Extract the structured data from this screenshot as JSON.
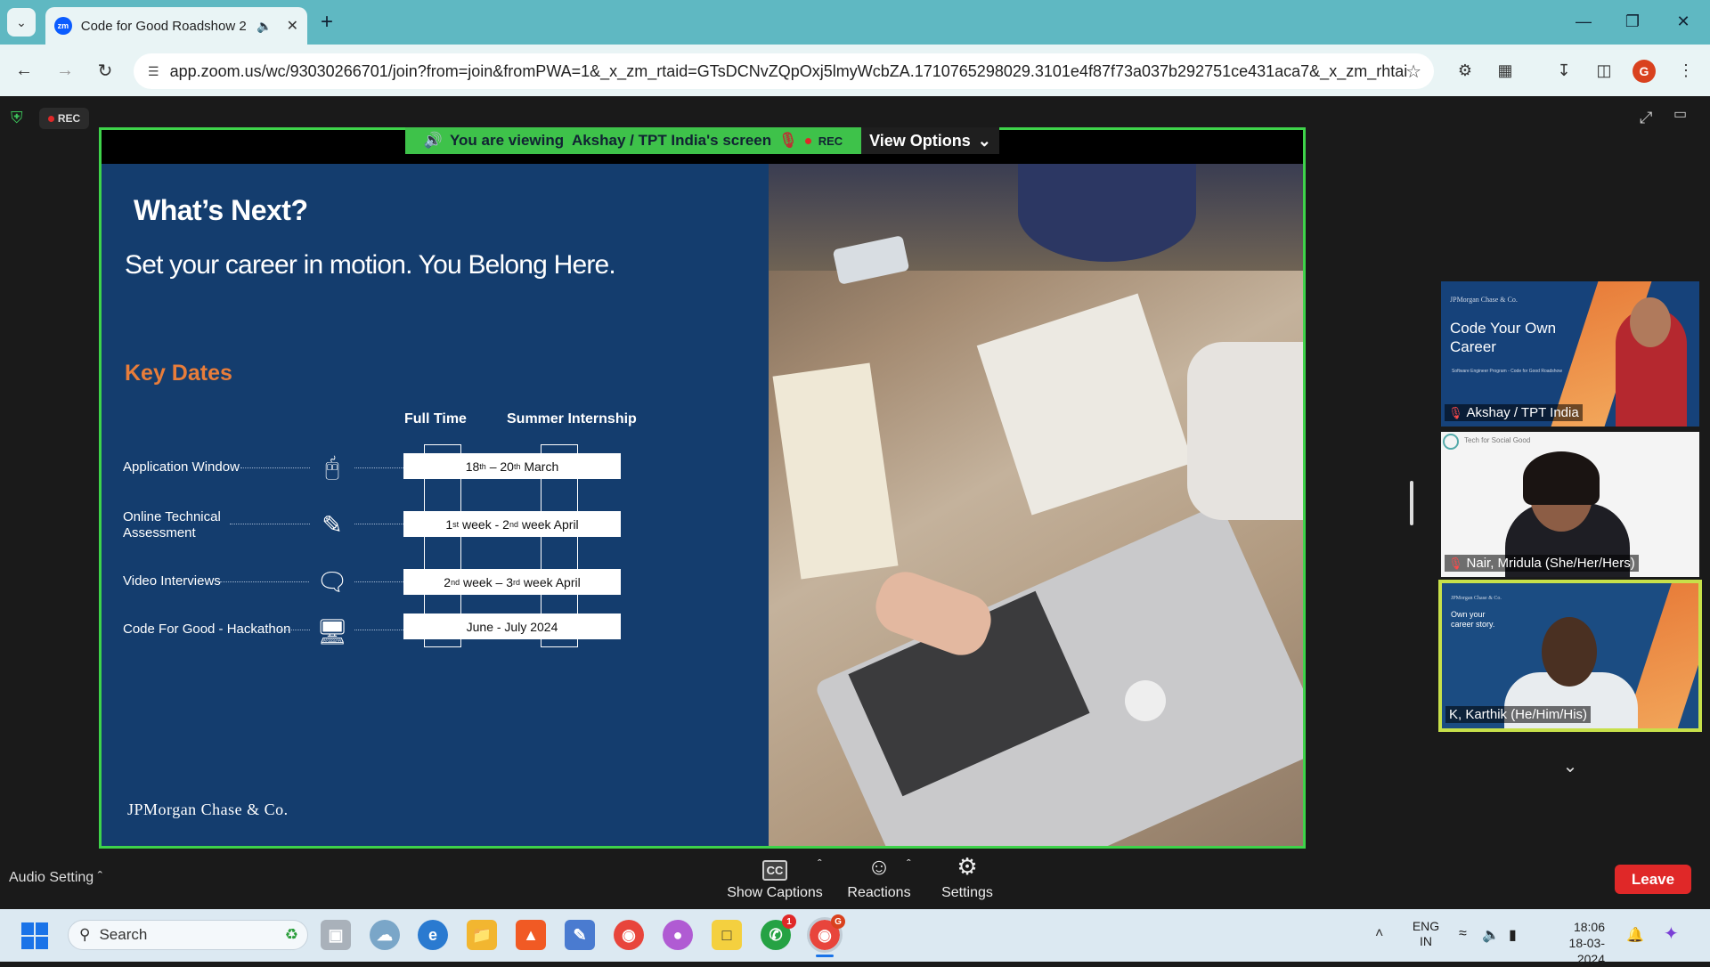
{
  "browser": {
    "tab_title": "Code for Good Roadshow 2",
    "tab_favicon": "zm",
    "url": "app.zoom.us/wc/93030266701/join?from=join&fromPWA=1&_x_zm_rtaid=GTsDCNvZQpOxj5lmyWcbZA.1710765298029.3101e4f87f73a037b292751ce431aca7&_x_zm_rhtaid=...",
    "profile_initial": "G"
  },
  "zoom": {
    "rec_label": "REC",
    "banner_text": "You are viewing  Akshay / TPT India's screen",
    "banner_rec": "REC",
    "view_options": "View Options",
    "audio_setting": "Audio Setting",
    "controls": {
      "captions": "Show Captions",
      "reactions": "Reactions",
      "settings": "Settings",
      "cc_glyph": "CC"
    },
    "leave": "Leave",
    "participants": [
      {
        "name": "Akshay / TPT India",
        "muted": true,
        "slide_title": "Code Your Own Career",
        "slide_brand": "JPMorgan Chase & Co.",
        "slide_caption": "Software Engineer Program - Code for Good Roadshow"
      },
      {
        "name": "Nair, Mridula (She/Her/Hers)",
        "muted": true,
        "bg_label": "Tech for Social Good"
      },
      {
        "name": "K, Karthik (He/Him/His)",
        "muted": false,
        "bg_brand": "JPMorgan Chase & Co.",
        "bg_text": "Own your career story."
      }
    ]
  },
  "slide": {
    "heading": "What’s Next?",
    "tagline": "Set your career in motion. You Belong Here.",
    "key_dates_title": "Key Dates",
    "col_full_time": "Full Time",
    "col_internship": "Summer Internship",
    "rows": [
      {
        "label": "Application Window",
        "icon": "monitor-touch-icon",
        "date_a": "18",
        "sup_a": "th",
        "mid": " – 20",
        "sup_b": "th",
        "date_b": " March"
      },
      {
        "label": "Online Technical Assessment",
        "icon": "pencil-ruler-icon",
        "date_a": "1",
        "sup_a": "st",
        "mid": " week - 2",
        "sup_b": "nd",
        "date_b": " week April"
      },
      {
        "label": "Video Interviews",
        "icon": "chat-bubbles-icon",
        "date_a": "2",
        "sup_a": "nd",
        "mid": " week – 3",
        "sup_b": "rd",
        "date_b": " week April"
      },
      {
        "label": "Code For Good - Hackathon",
        "icon": "devices-icon",
        "date_plain": "June - July 2024"
      }
    ],
    "logo": "JPMorgan Chase & Co."
  },
  "taskbar": {
    "search_placeholder": "Search",
    "lang_1": "ENG",
    "lang_2": "IN",
    "time": "18:06",
    "date": "18-03-2024",
    "whatsapp_badge": "1",
    "chrome_badge": "G"
  }
}
